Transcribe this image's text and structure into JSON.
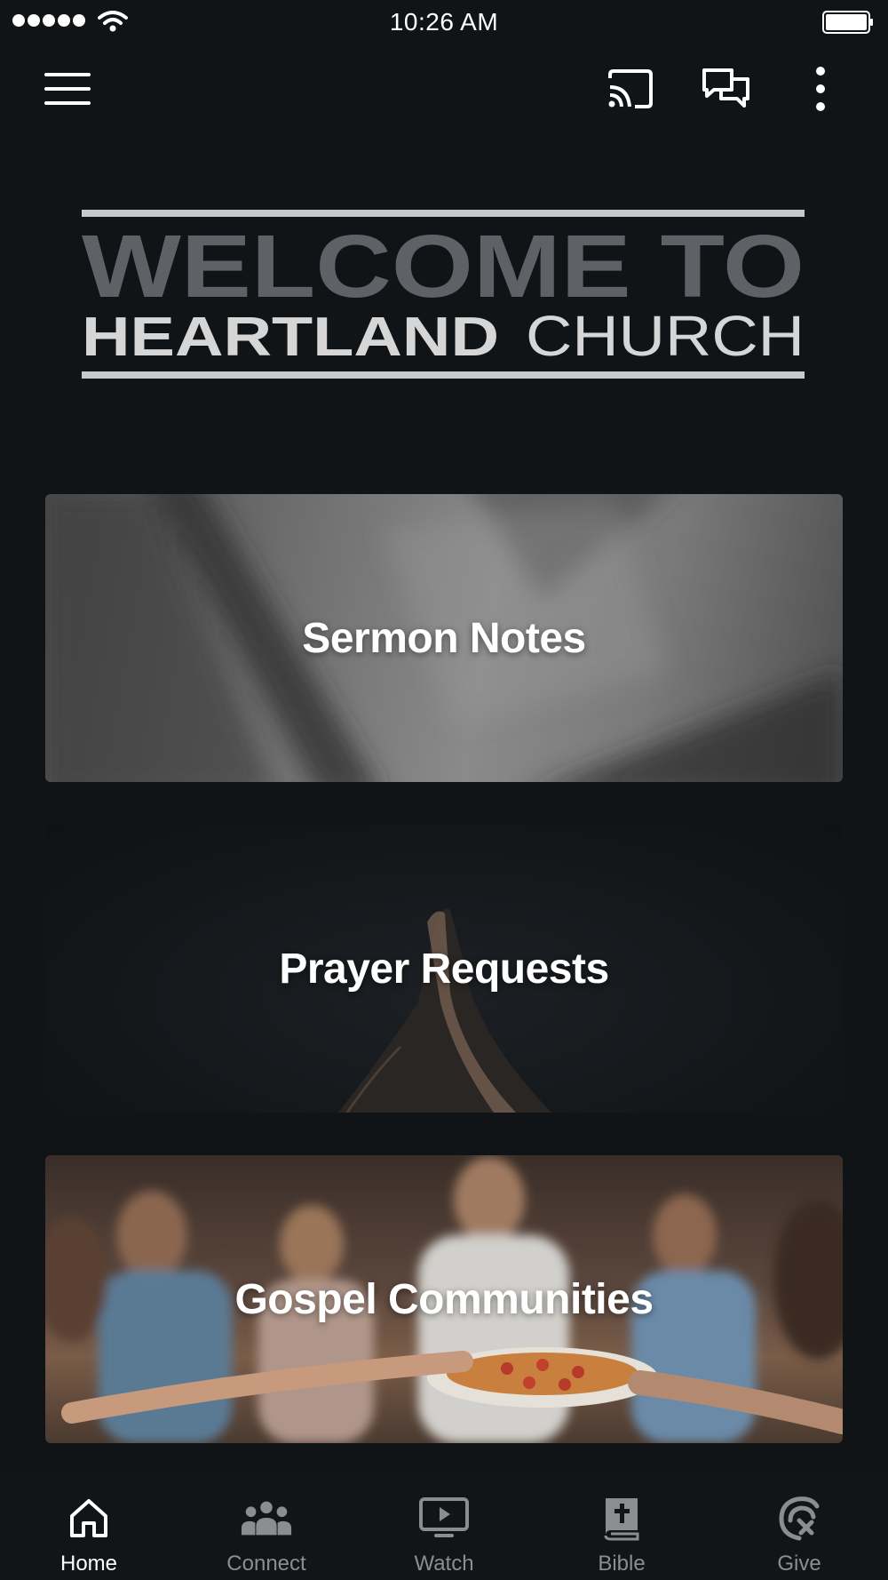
{
  "status_bar": {
    "time": "10:26 AM",
    "icons": [
      "signal-dots-icon",
      "wifi-icon",
      "battery-icon"
    ]
  },
  "app_bar": {
    "icons": [
      "hamburger-menu-icon",
      "cast-icon",
      "chat-icon",
      "more-vertical-icon"
    ]
  },
  "logo": {
    "line1": "WELCOME TO",
    "line2_bold": "HEARTLAND",
    "line2_light": "CHURCH",
    "colors": {
      "line1": "#5e6266",
      "line2": "#d6d6d6",
      "rules": "#c9c9c9"
    }
  },
  "cards": [
    {
      "title": "Sermon Notes",
      "image": "blurred-open-book-photo"
    },
    {
      "title": "Prayer Requests",
      "image": "raised-praying-hands-photo"
    },
    {
      "title": "Gospel Communities",
      "image": "friends-sharing-meal-photo"
    }
  ],
  "bottom_nav": {
    "items": [
      {
        "label": "Home",
        "icon": "home-icon",
        "active": true
      },
      {
        "label": "Connect",
        "icon": "people-icon",
        "active": false
      },
      {
        "label": "Watch",
        "icon": "tv-play-icon",
        "active": false
      },
      {
        "label": "Bible",
        "icon": "bible-icon",
        "active": false
      },
      {
        "label": "Give",
        "icon": "give-icon",
        "active": false
      }
    ]
  },
  "colors": {
    "background": "#111416",
    "nav_active": "#ffffff",
    "nav_inactive": "#8b8e91"
  }
}
